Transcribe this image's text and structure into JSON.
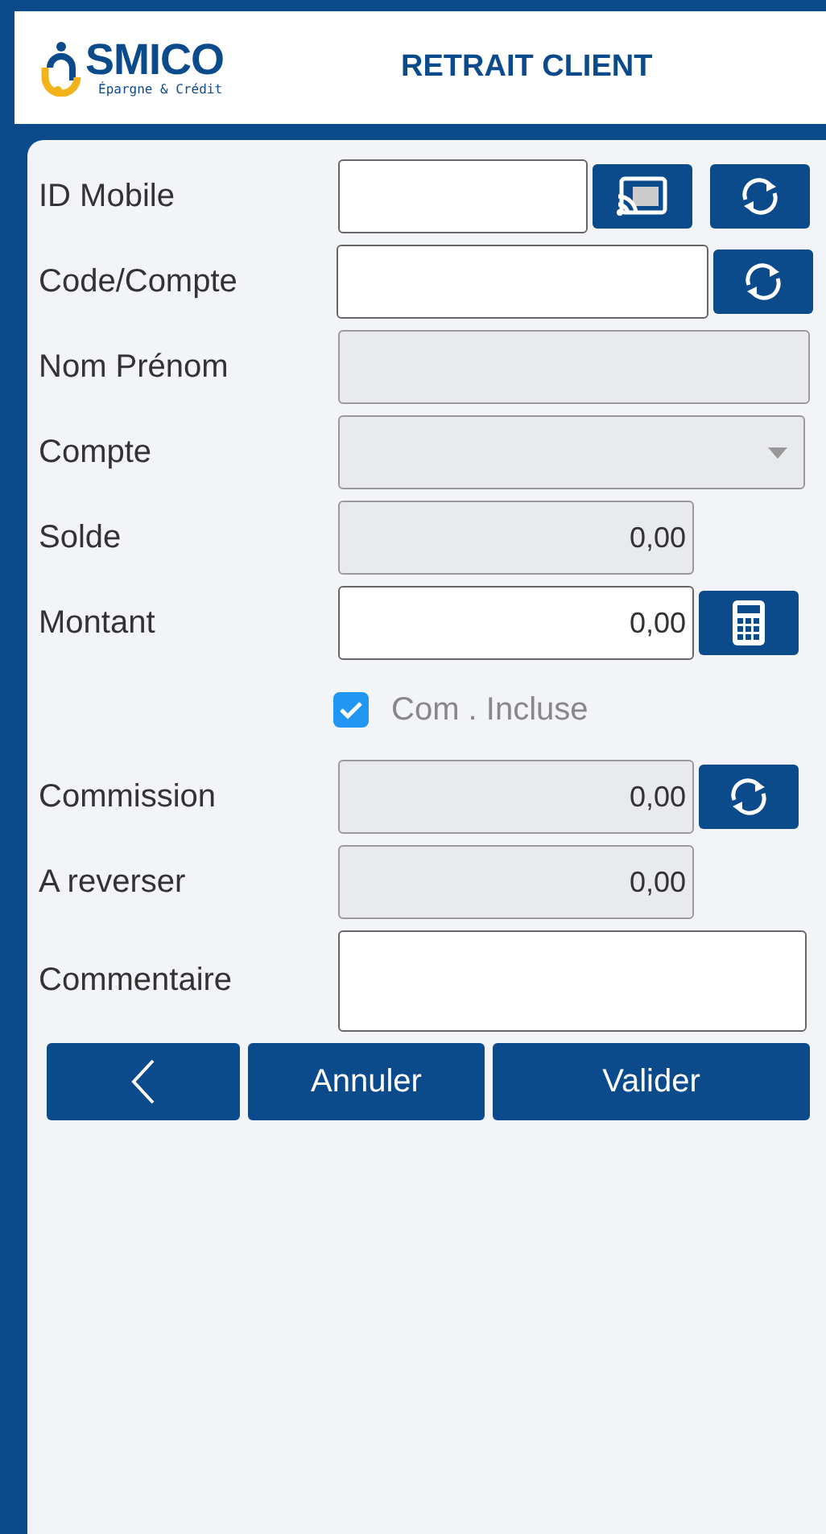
{
  "header": {
    "logo": {
      "name": "SMICO",
      "tagline": "Épargne & Crédit"
    },
    "title": "RETRAIT CLIENT"
  },
  "rows": [
    {
      "kind": "text",
      "label": "ID Mobile",
      "editable": true,
      "actions": [
        {
          "kind": "cast"
        },
        {
          "kind": "refresh"
        }
      ]
    },
    {
      "kind": "text",
      "label": "Code/Compte",
      "editable": true,
      "actions": [
        {
          "kind": "refresh"
        }
      ]
    },
    {
      "kind": "text",
      "label": "Nom  Prénom",
      "editable": false
    },
    {
      "kind": "select",
      "label": "Compte",
      "editable": false
    },
    {
      "kind": "amount",
      "label": "Solde",
      "editable": false,
      "value": "0,00"
    },
    {
      "kind": "amount",
      "label": "Montant",
      "editable": true,
      "value": "0,00",
      "actions": [
        {
          "kind": "calculator"
        }
      ]
    },
    {
      "kind": "checkbox",
      "label": "Com . Incluse",
      "checked": true
    },
    {
      "kind": "amount",
      "label": "Commission",
      "editable": false,
      "value": "0,00",
      "actions": [
        {
          "kind": "refresh"
        }
      ]
    },
    {
      "kind": "amount",
      "label": "A reverser",
      "editable": false,
      "value": "0,00"
    },
    {
      "kind": "textarea",
      "label": "Commentaire",
      "editable": true
    }
  ],
  "buttons": [
    {
      "kind": "back"
    },
    {
      "kind": "text",
      "label": "Annuler"
    },
    {
      "kind": "text",
      "label": "Valider"
    }
  ]
}
